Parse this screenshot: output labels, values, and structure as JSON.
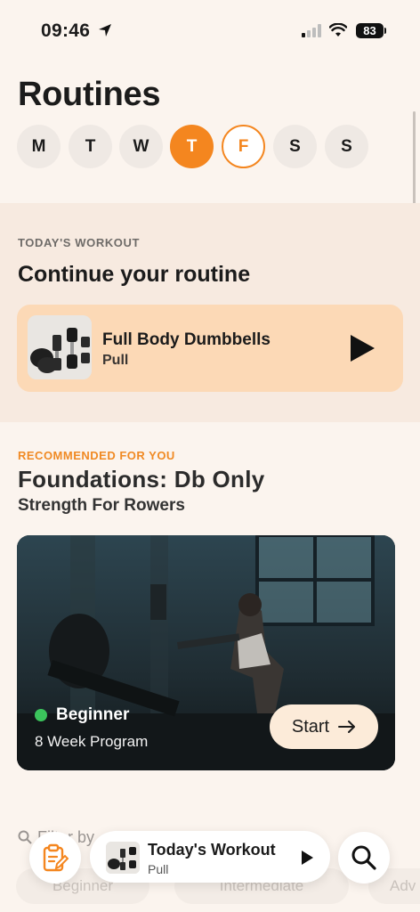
{
  "status_bar": {
    "time": "09:46",
    "battery": "83",
    "icons": [
      "location-arrow-icon",
      "signal-icon",
      "wifi-icon",
      "battery-icon"
    ]
  },
  "page_title": "Routines",
  "week_days": [
    {
      "label": "M",
      "state": "default"
    },
    {
      "label": "T",
      "state": "default"
    },
    {
      "label": "W",
      "state": "default"
    },
    {
      "label": "T",
      "state": "today"
    },
    {
      "label": "F",
      "state": "selected"
    },
    {
      "label": "S",
      "state": "default"
    },
    {
      "label": "S",
      "state": "default"
    }
  ],
  "today": {
    "overline": "TODAY'S WORKOUT",
    "title": "Continue your routine",
    "workout_name": "Full Body Dumbbells",
    "workout_sub": "Pull"
  },
  "recommended": {
    "overline": "RECOMMENDED FOR YOU",
    "title": "Foundations: Db Only",
    "subtitle": "Strength For Rowers",
    "level": "Beginner",
    "length": "8 Week Program",
    "start_label": "Start"
  },
  "filters": {
    "search_text": "Filter by",
    "chips": [
      "Beginner",
      "Intermediate",
      "Adv"
    ]
  },
  "bottom_bar": {
    "title": "Today's Workout",
    "sub": "Pull"
  },
  "colors": {
    "accent": "#f4861f",
    "background": "#fbf4ee",
    "card": "#fcd9b6",
    "level_dot": "#3bc45c"
  }
}
